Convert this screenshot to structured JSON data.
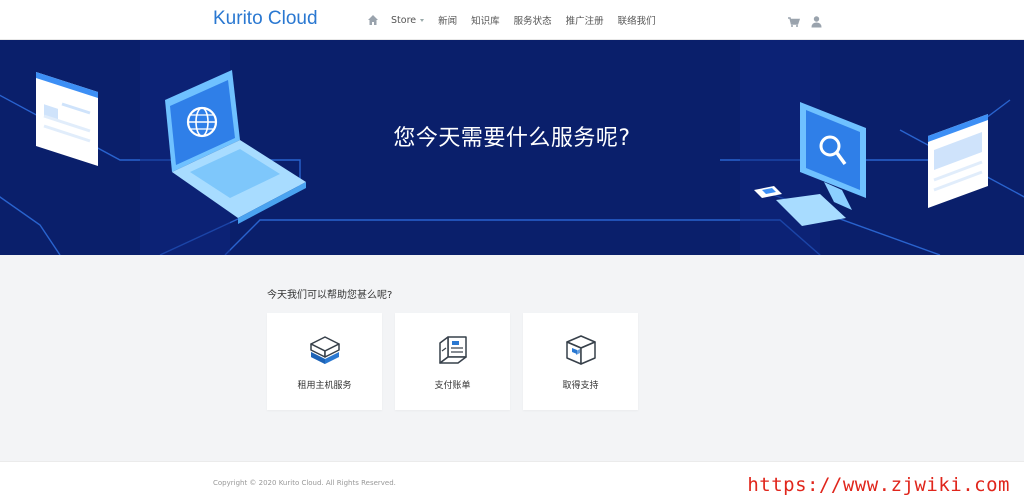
{
  "header": {
    "logo": "Kurito Cloud",
    "nav": [
      {
        "label": "Store",
        "has_dropdown": true
      },
      {
        "label": "新闻"
      },
      {
        "label": "知识库"
      },
      {
        "label": "服务状态"
      },
      {
        "label": "推广注册"
      },
      {
        "label": "联络我们"
      }
    ],
    "icons": [
      "home-icon",
      "cart-icon",
      "user-icon"
    ]
  },
  "banner": {
    "title": "您今天需要什么服务呢?",
    "background": "#0a1f6b"
  },
  "main": {
    "heading": "今天我们可以帮助您甚么呢?",
    "cards": [
      {
        "label": "租用主机服务",
        "icon": "server-box-icon"
      },
      {
        "label": "支付账单",
        "icon": "billing-box-icon"
      },
      {
        "label": "取得支持",
        "icon": "support-box-icon"
      }
    ]
  },
  "footer": {
    "copyright": "Copyright © 2020 Kurito Cloud. All Rights Reserved.",
    "watermark": "https://www.zjwiki.com"
  },
  "colors": {
    "accent": "#2a78d1",
    "banner": "#0a1f6b",
    "watermark": "#e0261c"
  }
}
